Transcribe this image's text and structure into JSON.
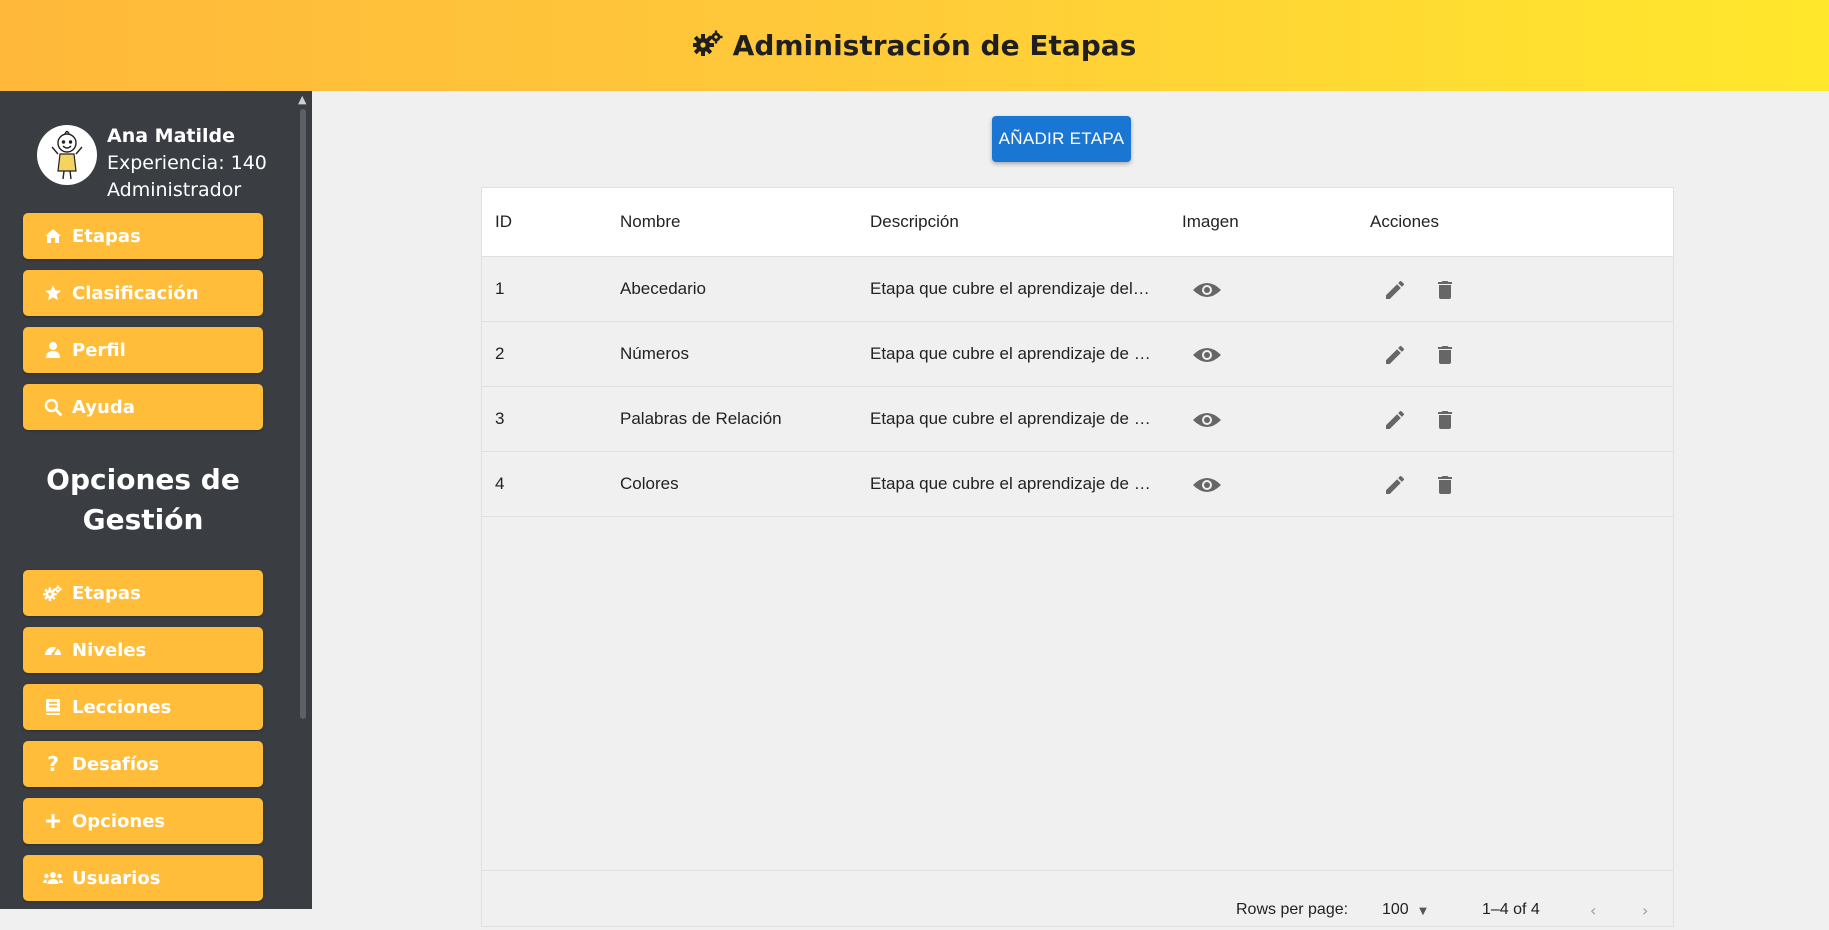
{
  "header": {
    "title": "Administración de Etapas",
    "icon": "gears-icon"
  },
  "user": {
    "name": "Ana Matilde",
    "experience": "Experiencia: 140",
    "role": "Administrador"
  },
  "sidebar": {
    "main_items": [
      {
        "label": "Etapas",
        "icon": "home-icon"
      },
      {
        "label": "Clasificación",
        "icon": "star-icon"
      },
      {
        "label": "Perfil",
        "icon": "user-icon"
      },
      {
        "label": "Ayuda",
        "icon": "search-icon"
      }
    ],
    "section_title": "Opciones de Gestión",
    "admin_items": [
      {
        "label": "Etapas",
        "icon": "gears-icon"
      },
      {
        "label": "Niveles",
        "icon": "gauge-icon"
      },
      {
        "label": "Lecciones",
        "icon": "book-icon"
      },
      {
        "label": "Desafíos",
        "icon": "question-icon"
      },
      {
        "label": "Opciones",
        "icon": "plus-icon"
      },
      {
        "label": "Usuarios",
        "icon": "users-icon"
      }
    ]
  },
  "main": {
    "add_button": "AÑADIR ETAPA",
    "table": {
      "columns": [
        "ID",
        "Nombre",
        "Descripción",
        "Imagen",
        "Acciones"
      ],
      "rows": [
        {
          "id": "1",
          "name": "Abecedario",
          "description": "Etapa que cubre el aprendizaje del abecedario"
        },
        {
          "id": "2",
          "name": "Números",
          "description": "Etapa que cubre el aprendizaje de los números"
        },
        {
          "id": "3",
          "name": "Palabras de Relación",
          "description": "Etapa que cubre el aprendizaje de palabras de relación"
        },
        {
          "id": "4",
          "name": "Colores",
          "description": "Etapa que cubre el aprendizaje de los colores"
        }
      ]
    },
    "pagination": {
      "rows_per_page_label": "Rows per page:",
      "rows_per_page_value": "100",
      "range": "1–4 of 4"
    }
  },
  "colors": {
    "header_gradient_start": "#ffb83a",
    "header_gradient_end": "#ffe82c",
    "sidebar_bg": "#3a3d42",
    "nav_button": "#ffbd3a",
    "primary_button": "#1976d2",
    "action_icon": "#666666"
  }
}
